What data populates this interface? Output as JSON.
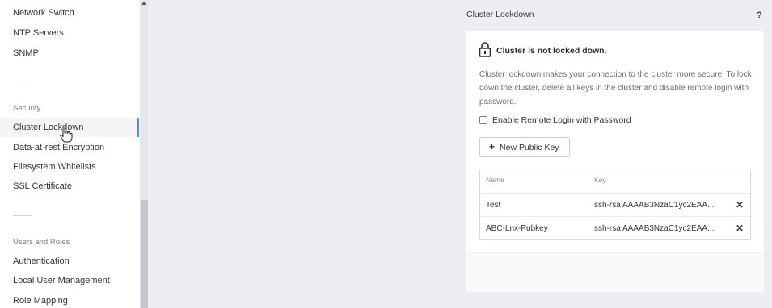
{
  "sidebar": {
    "items_top": [
      {
        "label": "Network Switch"
      },
      {
        "label": "NTP Servers"
      },
      {
        "label": "SNMP"
      }
    ],
    "security_header": "Security",
    "security_items": [
      {
        "label": "Cluster Lockdown",
        "active": true
      },
      {
        "label": "Data-at-rest Encryption"
      },
      {
        "label": "Filesystem Whitelists"
      },
      {
        "label": "SSL Certificate"
      }
    ],
    "users_header": "Users and Roles",
    "users_items": [
      {
        "label": "Authentication"
      },
      {
        "label": "Local User Management"
      },
      {
        "label": "Role Mapping"
      }
    ]
  },
  "main": {
    "title": "Cluster Lockdown",
    "help": "?",
    "status": "Cluster is not locked down.",
    "description": "Cluster lockdown makes your connection to the cluster more secure. To lock down the cluster, delete all keys in the cluster and disable remote login with password.",
    "checkbox_label": "Enable Remote Login with Password",
    "checkbox_checked": false,
    "new_key_button": "New Public Key",
    "table": {
      "headers": [
        "Name",
        "Key"
      ],
      "rows": [
        {
          "name": "Test",
          "key": "ssh-rsa AAAAB3NzaC1yc2EAA..."
        },
        {
          "name": "ABC-Lnx-Pubkey",
          "key": "ssh-rsa AAAAB3NzaC1yc2EAA..."
        }
      ],
      "delete_glyph": "✕"
    }
  },
  "icons": {
    "lock": "lock-icon",
    "cursor": "hand-pointer-icon",
    "delete": "close-icon"
  },
  "colors": {
    "active_indicator": "#3b9ae1",
    "background": "#edeef2"
  }
}
